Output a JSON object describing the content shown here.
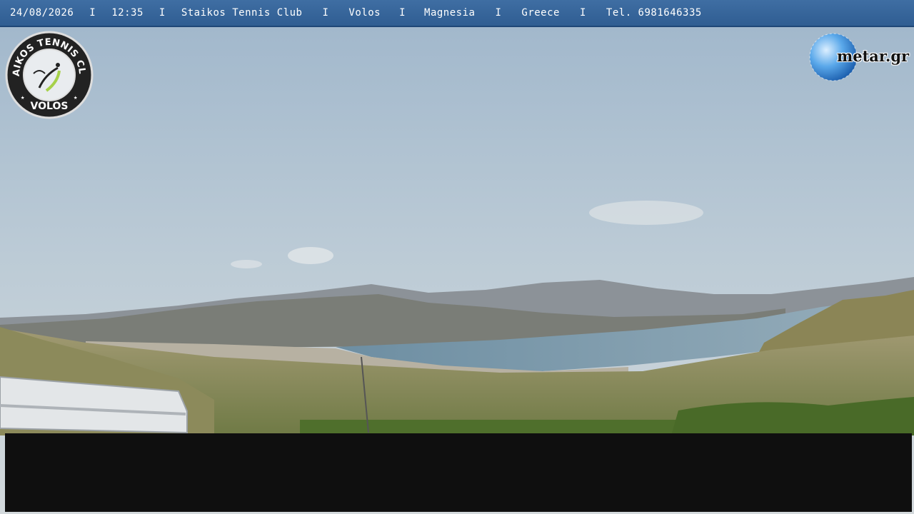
{
  "overlay": {
    "date": "24/08/2026",
    "time": "12:35",
    "club": "Staikos Tennis Club",
    "city": "Volos",
    "region": "Magnesia",
    "country": "Greece",
    "phone": "Tel. 6981646335",
    "separator": "I"
  },
  "club_logo": {
    "top_text": "STAIKOS TENNIS CLUB",
    "bottom_text": "VOLOS"
  },
  "watermark": {
    "text": "metar.gr"
  },
  "colors": {
    "bar": "#3466a0",
    "sea": "#6f8e9e",
    "sky": "#bccbd6",
    "panel": "#0f0f0f"
  }
}
